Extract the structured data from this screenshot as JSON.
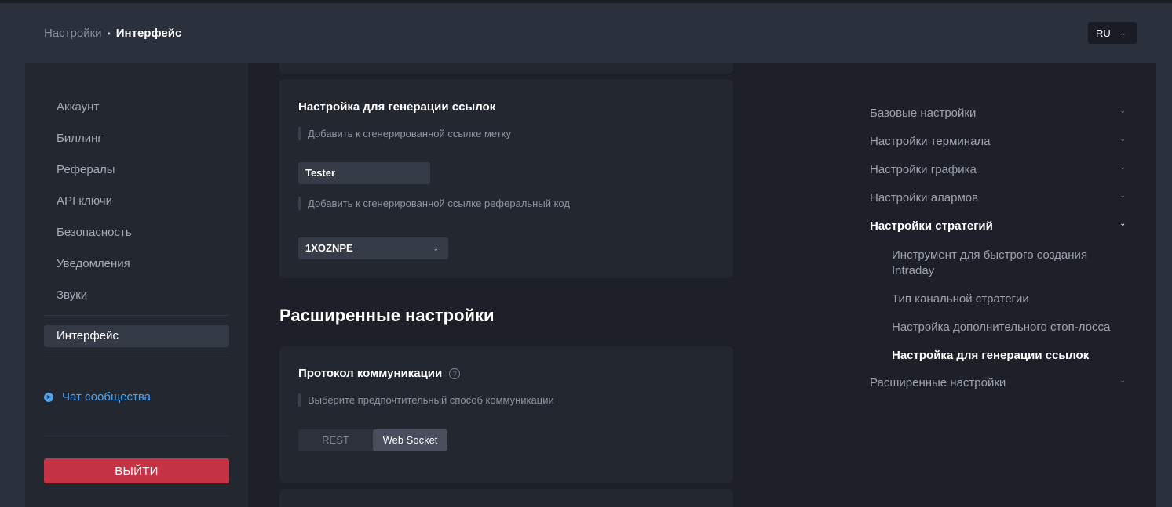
{
  "header": {
    "breadcrumb_parent": "Настройки",
    "breadcrumb_separator": "•",
    "breadcrumb_current": "Интерфейс",
    "language": "RU"
  },
  "sidebar": {
    "items": [
      {
        "label": "Аккаунт"
      },
      {
        "label": "Биллинг"
      },
      {
        "label": "Рефералы"
      },
      {
        "label": "API ключи"
      },
      {
        "label": "Безопасность"
      },
      {
        "label": "Уведомления"
      },
      {
        "label": "Звуки"
      },
      {
        "label": "Интерфейс"
      }
    ],
    "chat_label": "Чат сообщества",
    "logout_label": "ВЫЙТИ"
  },
  "link_gen": {
    "title": "Настройка для генерации ссылок",
    "tag_hint": "Добавить к сгенерированной ссылке метку",
    "tag_value": "Tester",
    "ref_hint": "Добавить к сгенерированной ссылке реферальный код",
    "ref_value": "1XOZNPE"
  },
  "advanced": {
    "title": "Расширенные настройки",
    "protocol_title": "Протокол коммуникации",
    "protocol_hint": "Выберите предпочтительный способ коммуникации",
    "options": [
      "REST",
      "Web Socket"
    ],
    "selected": "Web Socket"
  },
  "toc": {
    "items": [
      {
        "label": "Базовые настройки"
      },
      {
        "label": "Настройки терминала"
      },
      {
        "label": "Настройки графика"
      },
      {
        "label": "Настройки алармов"
      },
      {
        "label": "Настройки стратегий"
      },
      {
        "label": "Расширенные настройки"
      }
    ],
    "sub_items": [
      {
        "label": "Инструмент для быстрого создания Intraday"
      },
      {
        "label": "Тип канальной стратегии"
      },
      {
        "label": "Настройка дополнительного стоп-лосса"
      },
      {
        "label": "Настройка для генерации ссылок"
      }
    ]
  },
  "colors": {
    "background": "#2b303d",
    "panel": "#1d2028",
    "sidebar": "#232730",
    "accent_link": "#4ea3f0",
    "logout": "#c53446"
  },
  "icons": {
    "chat": "telegram-icon",
    "help": "question-circle-icon",
    "chevron": "chevron-down-icon"
  }
}
